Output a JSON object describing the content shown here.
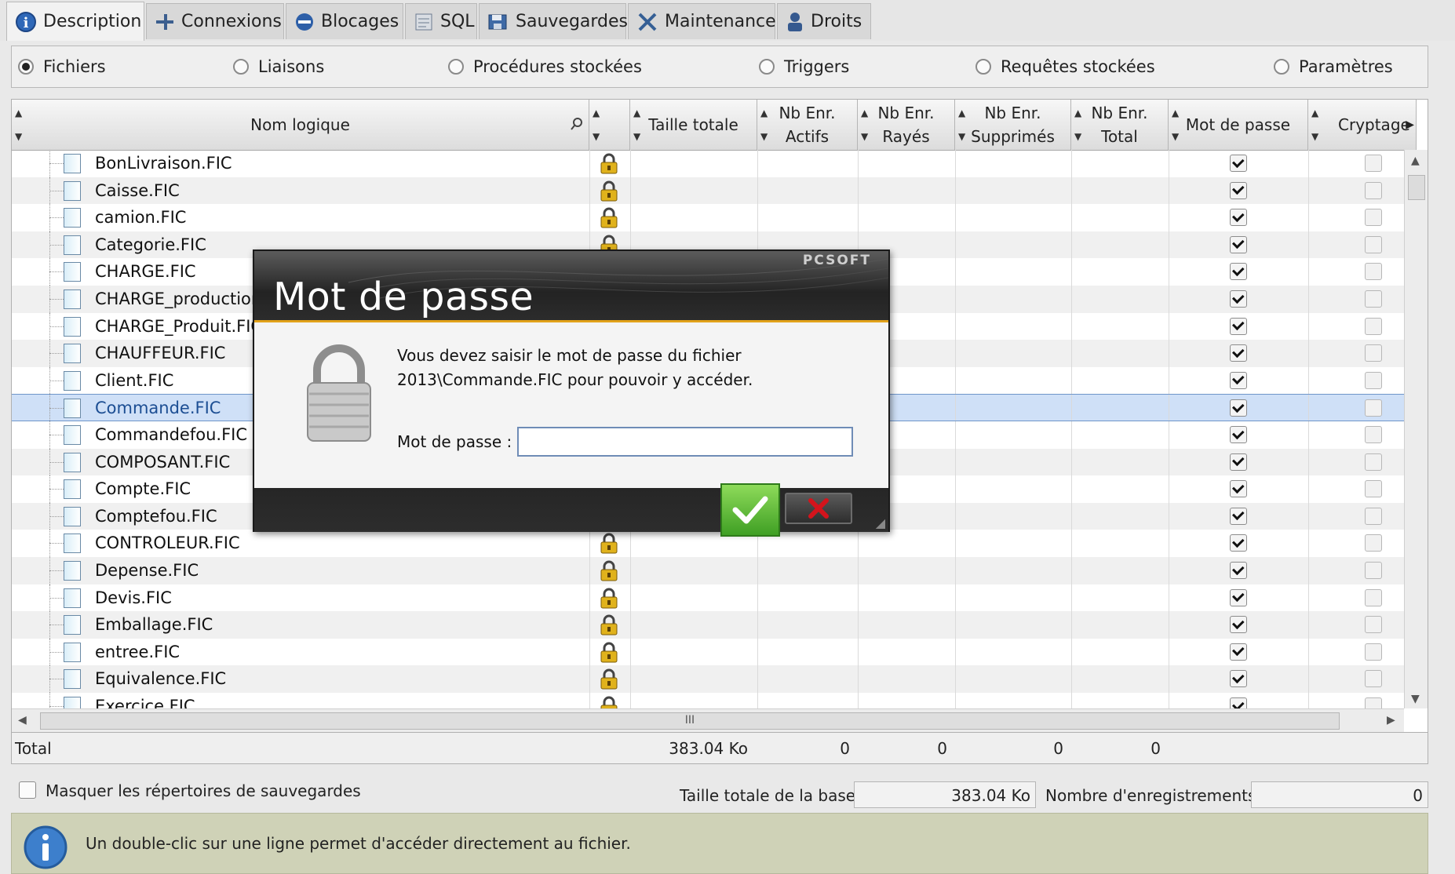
{
  "tabs": [
    {
      "label": "Description",
      "icon": "info-icon",
      "active": true
    },
    {
      "label": "Connexions",
      "icon": "connections-icon"
    },
    {
      "label": "Blocages",
      "icon": "blocked-icon"
    },
    {
      "label": "SQL",
      "icon": "sql-icon"
    },
    {
      "label": "Sauvegardes",
      "icon": "save-icon"
    },
    {
      "label": "Maintenance",
      "icon": "tools-icon"
    },
    {
      "label": "Droits",
      "icon": "rights-icon"
    }
  ],
  "view_options": [
    {
      "label": "Fichiers",
      "selected": true
    },
    {
      "label": "Liaisons",
      "selected": false
    },
    {
      "label": "Procédures stockées",
      "selected": false
    },
    {
      "label": "Triggers",
      "selected": false
    },
    {
      "label": "Requêtes stockées",
      "selected": false
    },
    {
      "label": "Paramètres",
      "selected": false
    }
  ],
  "table": {
    "columns": {
      "name": "Nom logique",
      "size": "Taille totale",
      "active_1": "Nb Enr.",
      "active_2": "Actifs",
      "deleted_1": "Nb Enr.",
      "deleted_2": "Rayés",
      "removed_1": "Nb Enr.",
      "removed_2": "Supprimés",
      "total_1": "Nb Enr.",
      "total_2": "Total",
      "password": "Mot de passe",
      "encryption": "Cryptage"
    },
    "rows": [
      {
        "name": "BonLivraison.FIC",
        "password": true,
        "encryption": false
      },
      {
        "name": "Caisse.FIC",
        "password": true,
        "encryption": false
      },
      {
        "name": "camion.FIC",
        "password": true,
        "encryption": false
      },
      {
        "name": "Categorie.FIC",
        "password": true,
        "encryption": false
      },
      {
        "name": "CHARGE.FIC",
        "password": true,
        "encryption": false
      },
      {
        "name": "CHARGE_production.FIC",
        "password": true,
        "encryption": false
      },
      {
        "name": "CHARGE_Produit.FIC",
        "password": true,
        "encryption": false
      },
      {
        "name": "CHAUFFEUR.FIC",
        "password": true,
        "encryption": false
      },
      {
        "name": "Client.FIC",
        "password": true,
        "encryption": false
      },
      {
        "name": "Commande.FIC",
        "password": true,
        "encryption": false,
        "selected": true
      },
      {
        "name": "Commandefou.FIC",
        "password": true,
        "encryption": false
      },
      {
        "name": "COMPOSANT.FIC",
        "password": true,
        "encryption": false
      },
      {
        "name": "Compte.FIC",
        "password": true,
        "encryption": false
      },
      {
        "name": "Comptefou.FIC",
        "password": true,
        "encryption": false
      },
      {
        "name": "CONTROLEUR.FIC",
        "password": true,
        "encryption": false
      },
      {
        "name": "Depense.FIC",
        "password": true,
        "encryption": false
      },
      {
        "name": "Devis.FIC",
        "password": true,
        "encryption": false
      },
      {
        "name": "Emballage.FIC",
        "password": true,
        "encryption": false
      },
      {
        "name": "entree.FIC",
        "password": true,
        "encryption": false
      },
      {
        "name": "Equivalence.FIC",
        "password": true,
        "encryption": false
      },
      {
        "name": "Exercice.FIC",
        "password": true,
        "encryption": false
      }
    ],
    "totals": {
      "label": "Total",
      "size": "383.04 Ko",
      "active": "0",
      "deleted": "0",
      "removed": "0",
      "total": "0"
    },
    "hscroll_grip": "III"
  },
  "bottom": {
    "hide_backups_label": "Masquer les répertoires de sauvegardes",
    "db_size_label": "Taille totale de la base",
    "db_size_value": "383.04 Ko",
    "records_label": "Nombre d'enregistrements",
    "records_value": "0"
  },
  "info": {
    "text": "Un double-clic sur une ligne permet d'accéder directement au fichier."
  },
  "dialog": {
    "title": "Mot de passe",
    "brand": "PCSOFT",
    "message_line1": "Vous devez saisir le mot de passe du fichier",
    "message_line2": "2013\\Commande.FIC pour pouvoir y accéder.",
    "password_label": "Mot de passe :",
    "password_value": "",
    "ok_icon": "checkmark-icon",
    "cancel_icon": "close-x-icon"
  },
  "colors": {
    "accent": "#e2a21a",
    "selection": "#cfe0f7",
    "ok_green": "#4fb52d",
    "cancel_red": "#d3141c",
    "info_bar": "#cfd2b7"
  }
}
